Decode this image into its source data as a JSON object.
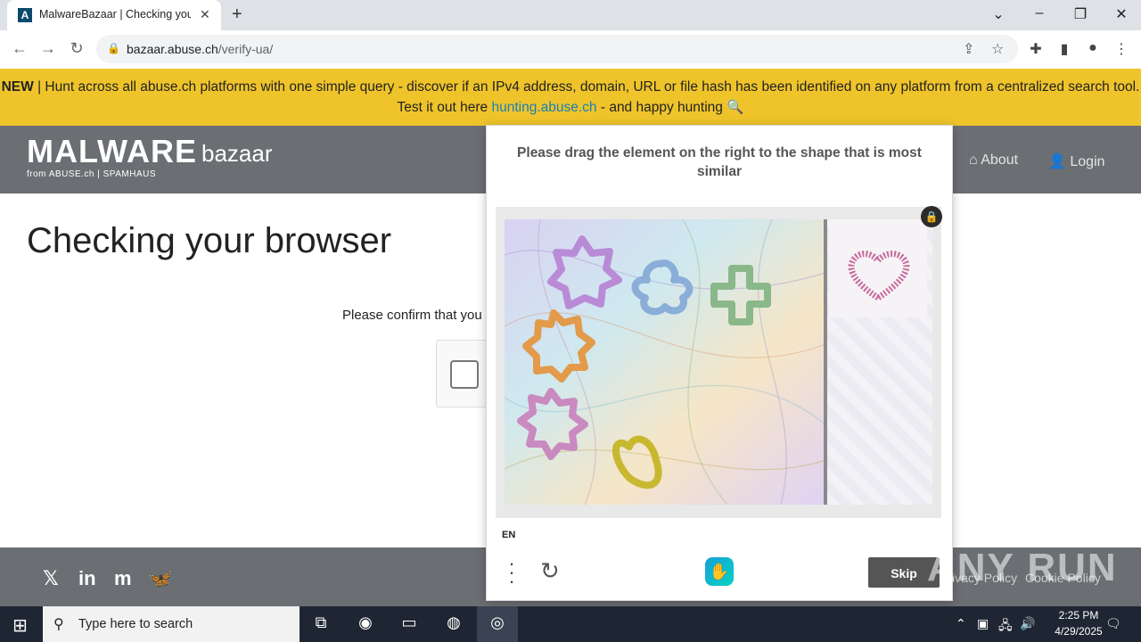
{
  "browser": {
    "tab_title": "MalwareBazaar | Checking your browser",
    "tab_favicon": "A",
    "url_host": "bazaar.abuse.ch",
    "url_path": "/verify-ua/",
    "icons": [
      "back-icon",
      "forward-icon",
      "reload-icon",
      "lock-icon",
      "share-icon",
      "star-icon",
      "extensions-icon",
      "sidepanel-icon",
      "profile-icon",
      "kebab-menu-icon"
    ]
  },
  "banner": {
    "new_label": "NEW",
    "text_1": " | Hunt across all abuse.ch platforms with one simple query - discover if an IPv4 address, domain, URL or file hash has been identified on any platform from a centralized search tool. Test it out here ",
    "link": "hunting.abuse.ch",
    "text_2": " - and happy hunting ",
    "emoji": "🔍"
  },
  "header": {
    "logo_main": "MALWARE",
    "logo_sub": "bazaar",
    "logo_from": "from ABUSE.ch | SPAMHAUS",
    "nav_about": "About",
    "nav_login": "Login"
  },
  "page": {
    "title": "Checking your browser",
    "confirm_text": "Please confirm that you"
  },
  "captcha": {
    "prompt": "Please drag the element on the right to the shape that is most similar",
    "lang": "EN",
    "skip_label": "Skip",
    "colors": {
      "skip_bg": "#555555"
    }
  },
  "footer": {
    "privacy": "Privacy Policy",
    "cookie": "Cookie Policy",
    "watermark": "ANY RUN"
  },
  "taskbar": {
    "search_placeholder": "Type here to search",
    "time": "2:25 PM",
    "date": "4/29/2025"
  }
}
